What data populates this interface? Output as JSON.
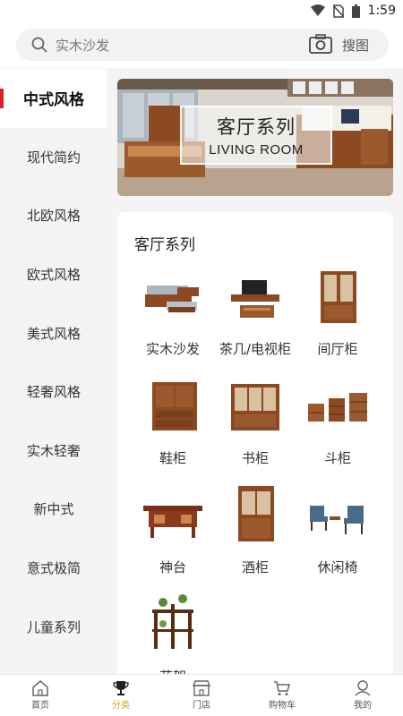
{
  "status": {
    "time": "1:59"
  },
  "search": {
    "placeholder": "实木沙发",
    "photo_search_label": "搜图"
  },
  "sidebar": {
    "items": [
      {
        "label": "中式风格",
        "active": true
      },
      {
        "label": "现代简约"
      },
      {
        "label": "北欧风格"
      },
      {
        "label": "欧式风格"
      },
      {
        "label": "美式风格"
      },
      {
        "label": "轻奢风格"
      },
      {
        "label": "实木轻奢"
      },
      {
        "label": "新中式"
      },
      {
        "label": "意式极简"
      },
      {
        "label": "儿童系列"
      }
    ]
  },
  "banner": {
    "title": "客厅系列",
    "subtitle": "LIVING ROOM"
  },
  "section": {
    "title": "客厅系列",
    "items": [
      {
        "label": "实木沙发",
        "icon": "sofa-icon"
      },
      {
        "label": "茶几/电视柜",
        "icon": "tv-cabinet-icon"
      },
      {
        "label": "间厅柜",
        "icon": "partition-cabinet-icon"
      },
      {
        "label": "鞋柜",
        "icon": "shoe-cabinet-icon"
      },
      {
        "label": "书柜",
        "icon": "bookcase-icon"
      },
      {
        "label": "斗柜",
        "icon": "chest-drawers-icon"
      },
      {
        "label": "神台",
        "icon": "altar-table-icon"
      },
      {
        "label": "酒柜",
        "icon": "wine-cabinet-icon"
      },
      {
        "label": "休闲椅",
        "icon": "leisure-chair-icon"
      },
      {
        "label": "花架",
        "icon": "flower-stand-icon"
      }
    ]
  },
  "tabbar": {
    "tabs": [
      {
        "label": "首页",
        "icon": "home-icon"
      },
      {
        "label": "分类",
        "icon": "trophy-icon",
        "active": true
      },
      {
        "label": "门店",
        "icon": "store-icon"
      },
      {
        "label": "购物车",
        "icon": "cart-icon"
      },
      {
        "label": "我的",
        "icon": "profile-icon"
      }
    ]
  },
  "colors": {
    "accent_red": "#e02020",
    "wood": "#8b4a22",
    "active_tab": "#d4a520"
  }
}
